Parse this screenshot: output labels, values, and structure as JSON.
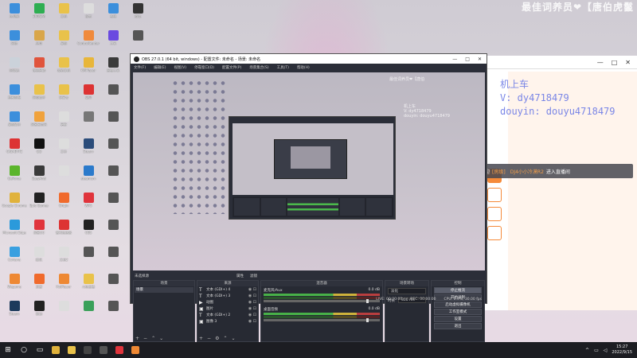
{
  "stream_title": "最佳词养员❤【唐伯虎鬣",
  "desktop_icons": [
    {
      "label": "此电脑",
      "color": "#3c8fdc"
    },
    {
      "label": "360安全",
      "color": "#2eae52"
    },
    {
      "label": "文档",
      "color": "#e9c24a"
    },
    {
      "label": "设置",
      "color": "#ddd"
    },
    {
      "label": "系统",
      "color": "#3c8fdc"
    },
    {
      "label": "游戏",
      "color": "#333"
    },
    {
      "label": "网络",
      "color": "#3c8fdc"
    },
    {
      "label": "应用",
      "color": "#d9a64a"
    },
    {
      "label": "桌面",
      "color": "#e9c24a"
    },
    {
      "label": "ControlCenter",
      "color": "#f08a3c"
    },
    {
      "label": "工具",
      "color": "#6a4ae0"
    },
    {
      "label": "",
      "color": "#555"
    },
    {
      "label": "回收站",
      "color": "#cbd2da"
    },
    {
      "label": "快速启动",
      "color": "#e0543c"
    },
    {
      "label": "我的文档",
      "color": "#e9c24a"
    },
    {
      "label": "KMPlayer",
      "color": "#e8b63a"
    },
    {
      "label": "直播工具",
      "color": "#3a3a3a"
    },
    {
      "label": "",
      "color": "#555"
    },
    {
      "label": "控制面板",
      "color": "#3c8fdc"
    },
    {
      "label": "网页助手",
      "color": "#e9c24a"
    },
    {
      "label": "记事本",
      "color": "#e9c24a"
    },
    {
      "label": "录屏",
      "color": "#d33"
    },
    {
      "label": "",
      "color": "#555"
    },
    {
      "label": "",
      "color": "#555"
    },
    {
      "label": "桌面软件",
      "color": "#3c8fdc"
    },
    {
      "label": "网易云音乐",
      "color": "#f0a23c"
    },
    {
      "label": "更新",
      "color": "#ddd"
    },
    {
      "label": "",
      "color": "#777"
    },
    {
      "label": "",
      "color": "#555"
    },
    {
      "label": "",
      "color": "#555"
    },
    {
      "label": "GIGABYTE",
      "color": "#d33"
    },
    {
      "label": "QQ",
      "color": "#111"
    },
    {
      "label": "文件",
      "color": "#ddd"
    },
    {
      "label": "Steam",
      "color": "#2b4c7a"
    },
    {
      "label": "",
      "color": "#555"
    },
    {
      "label": "",
      "color": "#555"
    },
    {
      "label": "GeForce",
      "color": "#5bb52b"
    },
    {
      "label": "EasyAnti",
      "color": "#3a3a3a"
    },
    {
      "label": "",
      "color": "#ddd"
    },
    {
      "label": "steamcm",
      "color": "#2b7acb"
    },
    {
      "label": "",
      "color": "#555"
    },
    {
      "label": "",
      "color": "#555"
    },
    {
      "label": "Google Chrome",
      "color": "#e0b23c"
    },
    {
      "label": "Epic Games",
      "color": "#222"
    },
    {
      "label": "Origin",
      "color": "#f06a2c"
    },
    {
      "label": "WPS",
      "color": "#e0343c"
    },
    {
      "label": "",
      "color": "#555"
    },
    {
      "label": "",
      "color": "#555"
    },
    {
      "label": "Microsoft Edge",
      "color": "#2b9adb"
    },
    {
      "label": "网易UU",
      "color": "#e0343c"
    },
    {
      "label": "雷神加速器",
      "color": "#d33"
    },
    {
      "label": "OBS",
      "color": "#222"
    },
    {
      "label": "",
      "color": "#555"
    },
    {
      "label": "",
      "color": "#555"
    },
    {
      "label": "Cortana",
      "color": "#3aa0e0"
    },
    {
      "label": "腾讯",
      "color": "#ddd"
    },
    {
      "label": "文档2",
      "color": "#ddd"
    },
    {
      "label": "",
      "color": "#555"
    },
    {
      "label": "",
      "color": "#555"
    },
    {
      "label": "",
      "color": "#555"
    },
    {
      "label": "Wegame",
      "color": "#ee8833"
    },
    {
      "label": "迅雷",
      "color": "#f06a2c"
    },
    {
      "label": "PotPlayer",
      "color": "#ee8833"
    },
    {
      "label": "斗鱼直播",
      "color": "#e9c24a"
    },
    {
      "label": "",
      "color": "#555"
    },
    {
      "label": "",
      "color": "#555"
    },
    {
      "label": "Steam",
      "color": "#1d3a5c"
    },
    {
      "label": "驱动",
      "color": "#222"
    },
    {
      "label": "",
      "color": "#ddd"
    },
    {
      "label": "",
      "color": "#3aa05a"
    },
    {
      "label": "",
      "color": "#555"
    },
    {
      "label": "",
      "color": "#555"
    }
  ],
  "browser": {
    "controls": [
      "—",
      "□",
      "✕"
    ]
  },
  "overlay": {
    "line1": "机上车",
    "line2": "V: dy4718479",
    "line3": "douyin: douyu4718479"
  },
  "toast": {
    "prefix": "欢迎",
    "tag": "[房级]",
    "user": "DJ4小小冷漠R2",
    "suffix": "进入直播间"
  },
  "obs": {
    "title": "OBS 27.0.1 (64 bit, windows) - 配置文件: 未命名 - 场景: 未命名",
    "window_controls": [
      "—",
      "□",
      "✕"
    ],
    "menu": [
      "文件(F)",
      "编辑(E)",
      "视图(V)",
      "停靠窗口(D)",
      "配置文件(P)",
      "场景集合(S)",
      "工具(T)",
      "帮助(H)"
    ],
    "preview_top_text": "最佳词养员❤【唐伯",
    "preview_right_text": [
      "机上车",
      "V: dy4718479",
      "douyin: douyu4718479"
    ],
    "scenebar": {
      "label": "未选择源",
      "btn1": "属性",
      "btn2": "滤镜"
    },
    "docks": {
      "scenes": {
        "header": "场景",
        "items": [
          "场景"
        ]
      },
      "sources": {
        "header": "来源",
        "items": [
          {
            "icon": "T",
            "label": "文本 (GDI+) 4"
          },
          {
            "icon": "T",
            "label": "文本 (GDI+) 3"
          },
          {
            "icon": "▶",
            "label": "动图"
          },
          {
            "icon": "▣",
            "label": "图片"
          },
          {
            "icon": "T",
            "label": "文本 (GDI+) 2"
          },
          {
            "icon": "▣",
            "label": "图像 3"
          }
        ]
      },
      "mixer": {
        "header": "混音器",
        "channels": [
          {
            "name": "麦克风/Aux",
            "db": "0.0 dB"
          },
          {
            "name": "桌面音频",
            "db": "0.0 dB"
          }
        ]
      },
      "transitions": {
        "header": "场景转场",
        "type": "淡化",
        "duration_label": "时长",
        "duration": "300 ms"
      },
      "controls": {
        "header": "控制",
        "buttons": [
          "停止推流",
          "开始录制",
          "启动虚拟摄像机",
          "工作室模式",
          "设置",
          "退出"
        ]
      }
    },
    "status": {
      "live": "LIVE: 00:00:00",
      "rec": "REC: 00:00:00",
      "cpu": "CPU: 0.9%, 30.00 fps"
    }
  },
  "taskbar": {
    "items": [
      {
        "name": "start",
        "glyph": "⊞",
        "color": "#fff"
      },
      {
        "name": "search",
        "glyph": "○",
        "color": "#fff"
      },
      {
        "name": "task-view",
        "glyph": "▭",
        "color": "#fff"
      },
      {
        "name": "chrome",
        "color": "#e0b23c"
      },
      {
        "name": "explorer",
        "color": "#e9c24a"
      },
      {
        "name": "obs",
        "color": "#444"
      },
      {
        "name": "app1",
        "color": "#555"
      },
      {
        "name": "netease",
        "color": "#e0343c"
      },
      {
        "name": "douyu",
        "color": "#ee8833"
      }
    ],
    "time": "15:27",
    "date": "2022/9/15"
  }
}
